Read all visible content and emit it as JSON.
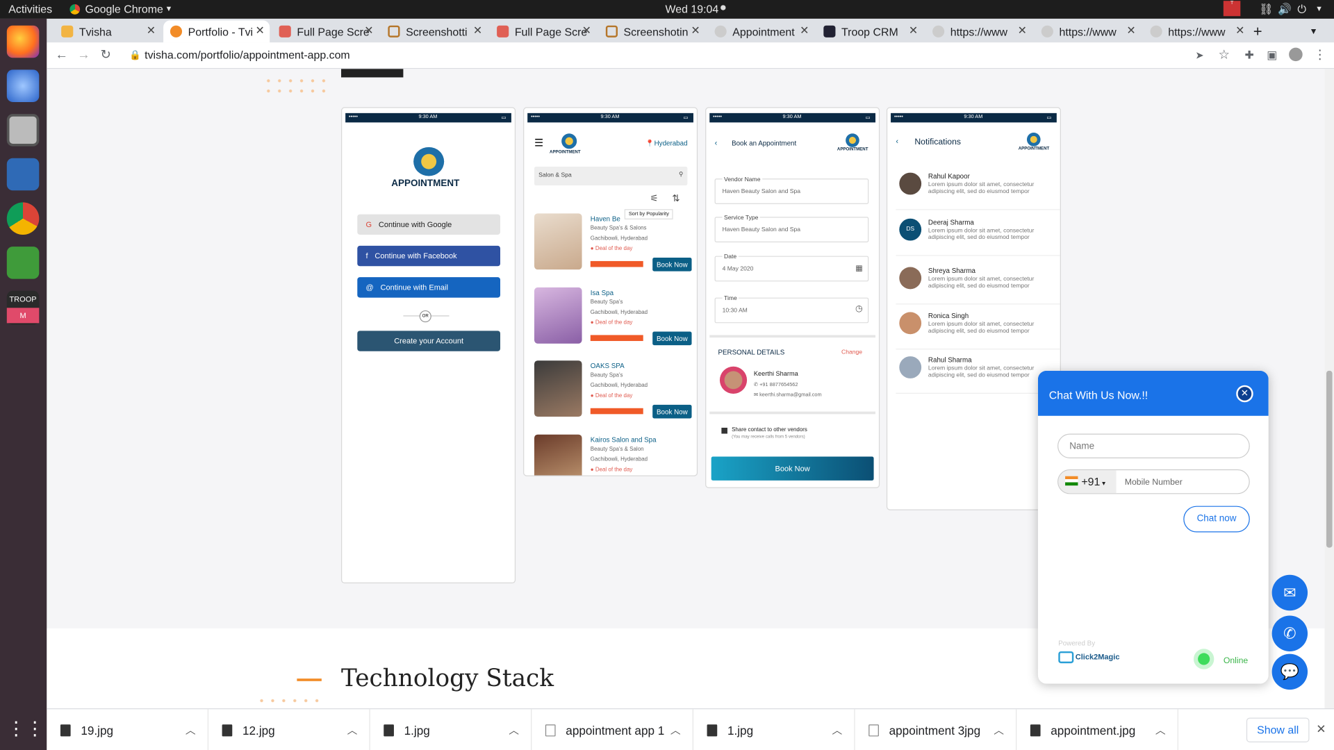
{
  "system": {
    "activities": "Activities",
    "app_menu": "Google Chrome",
    "clock": "Wed 19:04",
    "dock_troop": "TROOP",
    "dock_troop_sub": "M"
  },
  "tabs": [
    {
      "label": "Tvisha"
    },
    {
      "label": "Portfolio - Tvi"
    },
    {
      "label": "Full Page Scre"
    },
    {
      "label": "Screenshotti"
    },
    {
      "label": "Full Page Scre"
    },
    {
      "label": "Screenshotin"
    },
    {
      "label": "Appointment"
    },
    {
      "label": "Troop CRM"
    },
    {
      "label": "https://www"
    },
    {
      "label": "https://www"
    },
    {
      "label": "https://www"
    }
  ],
  "address": {
    "url": "tvisha.com/portfolio/appointment-app.com"
  },
  "phones": {
    "status_time": "9:30 AM",
    "login": {
      "brand": "APPOINTMENT",
      "google": "Continue with Google",
      "facebook": "Continue with Facebook",
      "email": "Continue with Email",
      "or": "OR",
      "create": "Create your Account"
    },
    "list": {
      "location": "Hyderabad",
      "brand": "APPOINTMENT",
      "search": "Salon & Spa",
      "tooltip": "Sort by Popularity",
      "deal": "Deal of the day",
      "book": "Book Now",
      "items": [
        {
          "name": "Haven Be",
          "type": "Beauty Spa's & Salons",
          "place": "Gachibowli, Hyderabad"
        },
        {
          "name": "Isa Spa",
          "type": "Beauty Spa's",
          "place": "Gachibowli, Hyderabad"
        },
        {
          "name": "OAKS SPA",
          "type": "Beauty Spa's",
          "place": "Gachibowli, Hyderabad"
        },
        {
          "name": "Kairos Salon and Spa",
          "type": "Beauty Spa's & Salon",
          "place": "Gachibowli, Hyderabad"
        }
      ]
    },
    "booking": {
      "title": "Book an Appointment",
      "brand": "APPOINTMENT",
      "vendor_label": "Vendor Name",
      "vendor": "Haven Beauty Salon and Spa",
      "service_label": "Service Type",
      "service": "Haven Beauty Salon and Spa",
      "date_label": "Date",
      "date": "4 May 2020",
      "time_label": "Time",
      "time": "10:30 AM",
      "personal": "PERSONAL DETAILS",
      "change": "Change",
      "name": "Keerthi Sharma",
      "phone": "+91 8877654562",
      "email": "keerthi.sharma@gmail.com",
      "share": "Share contact to other vendors",
      "share_note": "(You may receive calls from 5 vendors)",
      "book": "Book Now"
    },
    "notifications": {
      "title": "Notifications",
      "brand": "APPOINTMENT",
      "lorem": "Lorem ipsum dolor sit amet, consectetur adipiscing elit, sed do eiusmod tempor",
      "items": [
        {
          "name": "Rahul Kapoor"
        },
        {
          "name": "Deeraj Sharma",
          "initials": "DS"
        },
        {
          "name": "Shreya Sharma"
        },
        {
          "name": "Ronica Singh"
        },
        {
          "name": "Rahul Sharma"
        }
      ]
    }
  },
  "section": {
    "title": "Technology Stack"
  },
  "chat": {
    "title": "Chat With Us Now.!!",
    "name_placeholder": "Name",
    "code": "+91",
    "mobile_placeholder": "Mobile Number",
    "button": "Chat now",
    "powered": "Powered By",
    "brand": "Click2Magic",
    "status": "Online"
  },
  "downloads": [
    {
      "label": "19.jpg"
    },
    {
      "label": "12.jpg"
    },
    {
      "label": "1.jpg"
    },
    {
      "label": "appointment app 1"
    },
    {
      "label": "1.jpg"
    },
    {
      "label": "appointment 3jpg"
    },
    {
      "label": "appointment.jpg"
    }
  ],
  "downloads_show_all": "Show all",
  "colors": {
    "accent": "#0b5f86",
    "chat_blue": "#1a73e8",
    "orange": "#f28c28",
    "dock": "#3a2d36"
  }
}
